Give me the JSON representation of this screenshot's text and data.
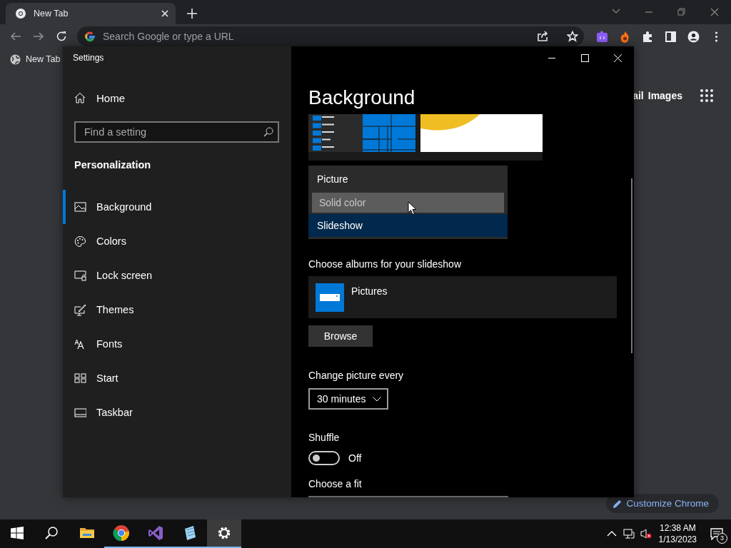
{
  "browser": {
    "tabs": [
      {
        "title": "New Tab",
        "selected": true
      }
    ],
    "omnibox": {
      "placeholder": "Search Google or type a URL"
    },
    "bookmarks": [
      {
        "label": "New Tab"
      }
    ],
    "header_links": [
      "ail",
      "Images"
    ],
    "customize_button": "Customize Chrome"
  },
  "settings": {
    "title": "Settings",
    "home": "Home",
    "search": {
      "placeholder": "Find a setting"
    },
    "section": "Personalization",
    "nav": [
      {
        "label": "Background",
        "selected": true
      },
      {
        "label": "Colors",
        "selected": false
      },
      {
        "label": "Lock screen",
        "selected": false
      },
      {
        "label": "Themes",
        "selected": false
      },
      {
        "label": "Fonts",
        "selected": false
      },
      {
        "label": "Start",
        "selected": false
      },
      {
        "label": "Taskbar",
        "selected": false
      }
    ],
    "heading": "Background",
    "background_options": [
      {
        "label": "Picture",
        "selected": false,
        "hovered": false
      },
      {
        "label": "Solid color",
        "selected": false,
        "hovered": true
      },
      {
        "label": "Slideshow",
        "selected": true,
        "hovered": false
      }
    ],
    "albums_label": "Choose albums for your slideshow",
    "albums": [
      {
        "name": "Pictures"
      }
    ],
    "browse_button": "Browse",
    "interval_label": "Change picture every",
    "interval": {
      "value": "30 minutes"
    },
    "shuffle": {
      "label": "Shuffle",
      "on": false,
      "state_text": "Off"
    },
    "fit_label": "Choose a fit"
  },
  "taskbar": {
    "apps": [
      {
        "kind": "explorer",
        "running": false,
        "active": false
      },
      {
        "kind": "chrome",
        "running": true,
        "active": false
      },
      {
        "kind": "visual-studio",
        "running": true,
        "active": false
      },
      {
        "kind": "notepad",
        "running": true,
        "active": false
      },
      {
        "kind": "settings",
        "running": true,
        "active": true
      }
    ],
    "time": "12:38 AM",
    "date": "1/13/2023",
    "notifications": "3"
  }
}
